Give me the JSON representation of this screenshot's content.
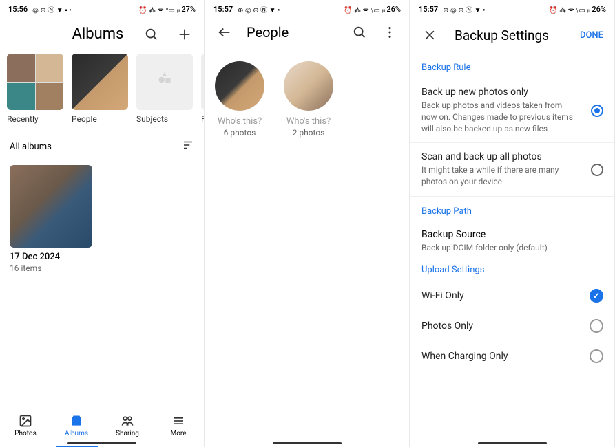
{
  "screens": {
    "albums": {
      "status": {
        "time": "15:56",
        "icons_left": "◎ ⊕ Ⓝ ▼ ▪ •",
        "icons_right": "⏰ ⁂ ᯤ ⫯▭ ᵢₗₗ",
        "battery": "27%"
      },
      "title": "Albums",
      "quick_albums": [
        {
          "label": "Recently",
          "type": "grid4"
        },
        {
          "label": "People",
          "type": "face"
        },
        {
          "label": "Subjects",
          "type": "subjects"
        },
        {
          "label": "F",
          "type": "blank"
        }
      ],
      "all_albums_label": "All albums",
      "big_album": {
        "title": "17 Dec 2024",
        "count": "16 items"
      },
      "nav": [
        {
          "label": "Photos",
          "icon": "image"
        },
        {
          "label": "Albums",
          "icon": "albums",
          "active": true
        },
        {
          "label": "Sharing",
          "icon": "sharing"
        },
        {
          "label": "More",
          "icon": "more"
        }
      ]
    },
    "people": {
      "status": {
        "time": "15:57",
        "icons_left": "⊕ ◎ ⊕ Ⓝ ▼ •",
        "icons_right": "⏰ ⁂ ᯤ ⫯▭ ᵢₗₗ",
        "battery": "26%"
      },
      "title": "People",
      "persons": [
        {
          "name": "Who's this?",
          "count": "6 photos"
        },
        {
          "name": "Who's this?",
          "count": "2 photos"
        }
      ]
    },
    "backup": {
      "status": {
        "time": "15:57",
        "icons_left": "⊕ ◎ ⊕ Ⓝ ▼ •",
        "icons_right": "⏰ ⁂ ᯤ ⫯▭ ᵢₗₗ",
        "battery": "26%"
      },
      "title": "Backup Settings",
      "done": "DONE",
      "backup_rule_label": "Backup Rule",
      "rules": [
        {
          "title": "Back up new photos only",
          "desc": "Back up photos and videos taken from now on. Changes made to previous items will also be backed up as new files",
          "selected": true
        },
        {
          "title": "Scan and back up all photos",
          "desc": "It might take a while if there are many photos on your device",
          "selected": false
        }
      ],
      "backup_path_label": "Backup Path",
      "backup_source": {
        "title": "Backup Source",
        "desc": "Back up DCIM folder only (default)"
      },
      "upload_settings_label": "Upload Settings",
      "toggles": [
        {
          "label": "Wi-Fi Only",
          "checked": true
        },
        {
          "label": "Photos Only",
          "checked": false
        },
        {
          "label": "When Charging Only",
          "checked": false
        }
      ]
    }
  }
}
